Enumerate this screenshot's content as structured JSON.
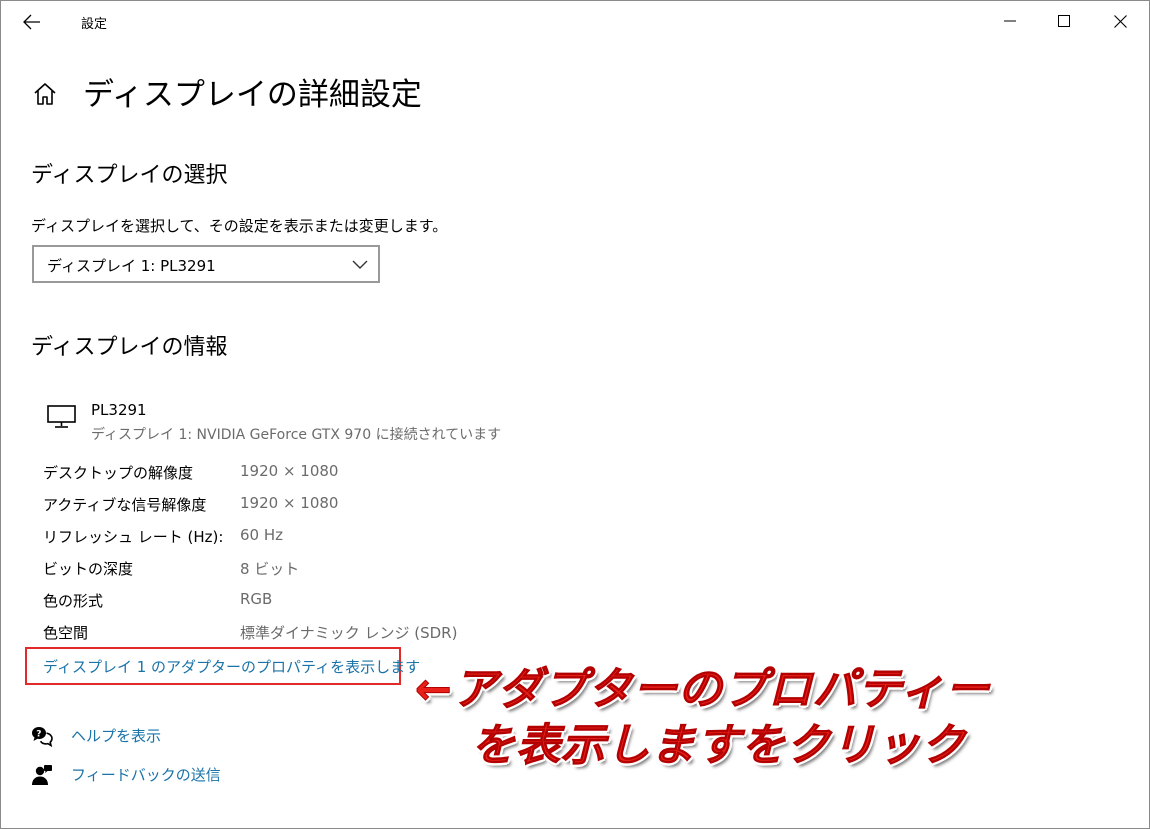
{
  "window": {
    "app_title": "設定",
    "back_icon": "back-arrow-icon",
    "minimize_icon": "minimize-icon",
    "maximize_icon": "maximize-icon",
    "close_icon": "close-icon"
  },
  "header": {
    "home_icon": "home-icon",
    "page_title": "ディスプレイの詳細設定"
  },
  "select_section": {
    "heading": "ディスプレイの選択",
    "description": "ディスプレイを選択して、その設定を表示または変更します。",
    "dropdown_value": "ディスプレイ 1: PL3291"
  },
  "info_section": {
    "heading": "ディスプレイの情報",
    "monitor_icon": "monitor-icon",
    "monitor_name": "PL3291",
    "monitor_sub": "ディスプレイ 1: NVIDIA GeForce GTX 970 に接続されています",
    "rows": [
      {
        "label": "デスクトップの解像度",
        "value": "1920 × 1080"
      },
      {
        "label": "アクティブな信号解像度",
        "value": "1920 × 1080"
      },
      {
        "label": "リフレッシュ レート (Hz):",
        "value": "60 Hz"
      },
      {
        "label": "ビットの深度",
        "value": "8 ビット"
      },
      {
        "label": "色の形式",
        "value": "RGB"
      },
      {
        "label": "色空間",
        "value": "標準ダイナミック レンジ (SDR)"
      }
    ],
    "adapter_link": "ディスプレイ 1 のアダプターのプロパティを表示します"
  },
  "annotation": {
    "line1": "←アダプターのプロパティー",
    "line2": "を表示しますをクリック",
    "color": "#e8201a",
    "box_color": "#e22a2a"
  },
  "help": {
    "items": [
      {
        "icon": "help-chat-icon",
        "label": "ヘルプを表示"
      },
      {
        "icon": "feedback-icon",
        "label": "フィードバックの送信"
      }
    ]
  },
  "colors": {
    "link": "#1a73a8",
    "secondary_text": "#6b6b6b"
  }
}
